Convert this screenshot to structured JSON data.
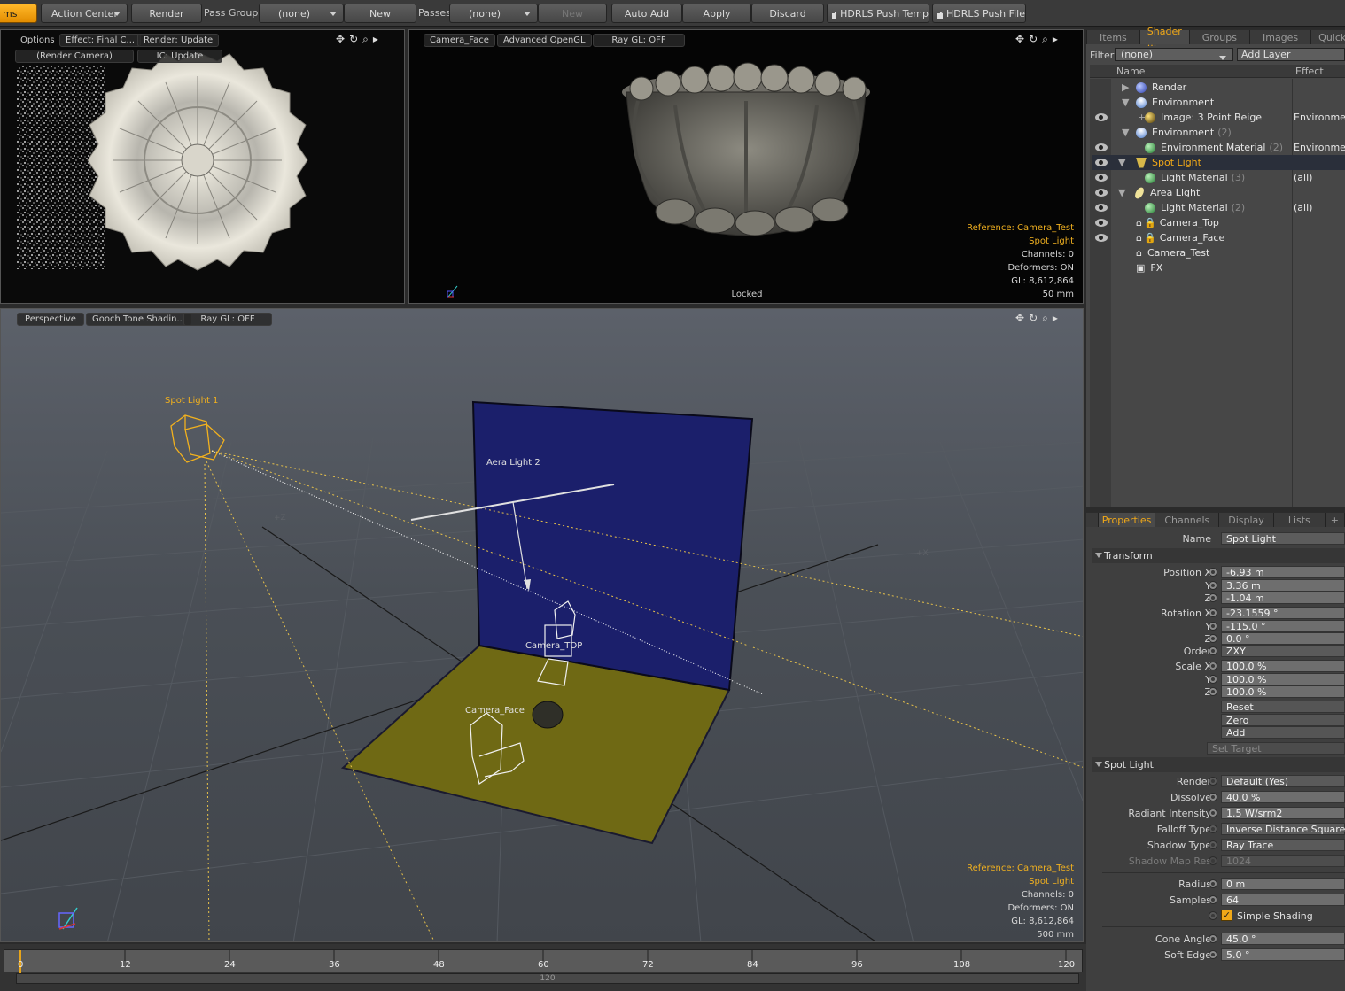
{
  "toolbar": {
    "items_tab": "ms",
    "action_center": "Action Center",
    "render": "Render",
    "pass_groups_label": "Pass Groups",
    "pass_groups_value": "(none)",
    "new1": "New",
    "passes_label": "Passes",
    "passes_value": "(none)",
    "new2": "New",
    "auto_add": "Auto Add",
    "apply": "Apply",
    "discard": "Discard",
    "hdrls_temp": "HDRLS Push Temp",
    "hdrls_file": "HDRLS Push File"
  },
  "preview": {
    "options": "Options",
    "effect": "Effect: Final C...",
    "render_update": "Render: Update",
    "render_camera": "(Render Camera)",
    "ic_update": "IC: Update"
  },
  "camview": {
    "camera": "Camera_Face",
    "gl": "Advanced OpenGL",
    "raygl": "Ray GL: OFF",
    "reference": "Reference: Camera_Test",
    "selected": "Spot Light",
    "channels": "Channels: 0",
    "deformers": "Deformers: ON",
    "glcount": "GL: 8,612,864",
    "lens": "50 mm",
    "locked": "Locked"
  },
  "persp": {
    "view": "Perspective",
    "shading": "Gooch Tone Shadin...",
    "raygl": "Ray GL: OFF",
    "spot_light": "Spot Light 1",
    "area_light": "Aera Light 2",
    "camera_top": "Camera_TOP",
    "camera_face": "Camera_Face",
    "axis_z": "+Z",
    "axis_x": "+X",
    "reference": "Reference: Camera_Test",
    "selected": "Spot Light",
    "channels": "Channels: 0",
    "deformers": "Deformers: ON",
    "glcount": "GL: 8,612,864",
    "lens": "500 mm"
  },
  "timeline": {
    "ticks": [
      "0",
      "12",
      "24",
      "36",
      "48",
      "60",
      "72",
      "84",
      "96",
      "108",
      "120"
    ],
    "end": "120"
  },
  "shader": {
    "tabs": [
      "Items",
      "Shader ...",
      "Groups",
      "Images",
      "Quick"
    ],
    "filter_label": "Filter",
    "filter_value": "(none)",
    "add_layer": "Add Layer",
    "col_name": "Name",
    "col_effect": "Effect",
    "rows": [
      {
        "name": "Render",
        "count": "",
        "effect": "",
        "icon": "blue"
      },
      {
        "name": "Environment",
        "count": "",
        "effect": "",
        "icon": "env"
      },
      {
        "name": "Image: 3 Point Beige",
        "count": "",
        "effect": "Environmen",
        "icon": "gold"
      },
      {
        "name": "Environment",
        "count": "(2)",
        "effect": "",
        "icon": "env"
      },
      {
        "name": "Environment Material",
        "count": "(2)",
        "effect": "Environmen",
        "icon": "green"
      },
      {
        "name": "Spot Light",
        "count": "",
        "effect": "",
        "icon": "spot"
      },
      {
        "name": "Light Material",
        "count": "(3)",
        "effect": "(all)",
        "icon": "green"
      },
      {
        "name": "Area Light",
        "count": "",
        "effect": "",
        "icon": "area"
      },
      {
        "name": "Light Material",
        "count": "(2)",
        "effect": "(all)",
        "icon": "green"
      },
      {
        "name": "Camera_Top",
        "count": "",
        "effect": "",
        "icon": "cam"
      },
      {
        "name": "Camera_Face",
        "count": "",
        "effect": "",
        "icon": "cam"
      },
      {
        "name": "Camera_Test",
        "count": "",
        "effect": "",
        "icon": "cam"
      },
      {
        "name": "FX",
        "count": "",
        "effect": "",
        "icon": "fx"
      }
    ]
  },
  "props": {
    "tabs": [
      "Properties",
      "Channels",
      "Display",
      "Lists",
      "+"
    ],
    "name_label": "Name",
    "name_value": "Spot Light",
    "transform": "Transform",
    "position_x": "Position X",
    "pos_x": "-6.93 m",
    "y": "Y",
    "pos_y": "3.36 m",
    "z": "Z",
    "pos_z": "-1.04 m",
    "rotation_x": "Rotation X",
    "rot_x": "-23.1559 °",
    "rot_y": "-115.0 °",
    "rot_z": "0.0 °",
    "order_label": "Order",
    "order": "ZXY",
    "scale_x": "Scale X",
    "sc_x": "100.0 %",
    "sc_y": "100.0 %",
    "sc_z": "100.0 %",
    "reset": "Reset",
    "zero": "Zero",
    "add": "Add",
    "set_target": "Set Target",
    "spot_section": "Spot Light",
    "render_label": "Render",
    "render": "Default (Yes)",
    "dissolve_label": "Dissolve",
    "dissolve": "40.0 %",
    "radiant_label": "Radiant Intensity",
    "radiant": "1.5 W/srm2",
    "falloff_label": "Falloff Type",
    "falloff": "Inverse Distance Squared",
    "shadow_label": "Shadow Type",
    "shadow": "Ray Trace",
    "shadowres_label": "Shadow Map Res",
    "shadowres": "1024",
    "radius_label": "Radius",
    "radius": "0 m",
    "samples_label": "Samples",
    "samples": "64",
    "simple_shading": "Simple Shading",
    "cone_label": "Cone Angle",
    "cone": "45.0 °",
    "soft_label": "Soft Edge",
    "soft": "5.0 °"
  }
}
